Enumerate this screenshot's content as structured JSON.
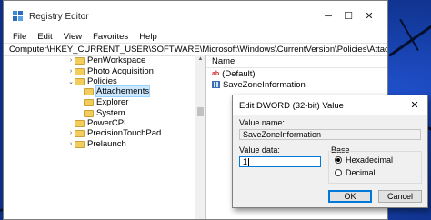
{
  "window": {
    "title": "Registry Editor",
    "controls": {
      "minimize": "─",
      "maximize": "☐",
      "close": "✕"
    }
  },
  "menu": [
    "File",
    "Edit",
    "View",
    "Favorites",
    "Help"
  ],
  "address": "Computer\\HKEY_CURRENT_USER\\SOFTWARE\\Microsoft\\Windows\\CurrentVersion\\Policies\\Attachements",
  "tree": [
    {
      "label": "PenWorkspace",
      "chevron": "›",
      "indent": 0
    },
    {
      "label": "Photo Acquisition",
      "chevron": "›",
      "indent": 0
    },
    {
      "label": "Policies",
      "chevron": "⌄",
      "indent": 0
    },
    {
      "label": "Attachements",
      "chevron": "",
      "indent": 1,
      "selected": true
    },
    {
      "label": "Explorer",
      "chevron": "",
      "indent": 1
    },
    {
      "label": "System",
      "chevron": "",
      "indent": 1
    },
    {
      "label": "PowerCPL",
      "chevron": "",
      "indent": 0
    },
    {
      "label": "PrecisionTouchPad",
      "chevron": "›",
      "indent": 0
    },
    {
      "label": "Prelaunch",
      "chevron": "›",
      "indent": 0
    }
  ],
  "values_pane": {
    "column_header": "Name",
    "rows": [
      {
        "name": "(Default)",
        "icon": "string-value-icon"
      },
      {
        "name": "SaveZoneInformation",
        "icon": "dword-value-icon"
      }
    ]
  },
  "dialog": {
    "title": "Edit DWORD (32-bit) Value",
    "close": "✕",
    "value_name_label": "Value name:",
    "value_name": "SaveZoneInformation",
    "value_data_label": "Value data:",
    "value_data": "1",
    "base_label": "Base",
    "radio_hex": "Hexadecimal",
    "radio_dec": "Decimal",
    "selected_base": "Hexadecimal",
    "ok": "OK",
    "cancel": "Cancel"
  }
}
